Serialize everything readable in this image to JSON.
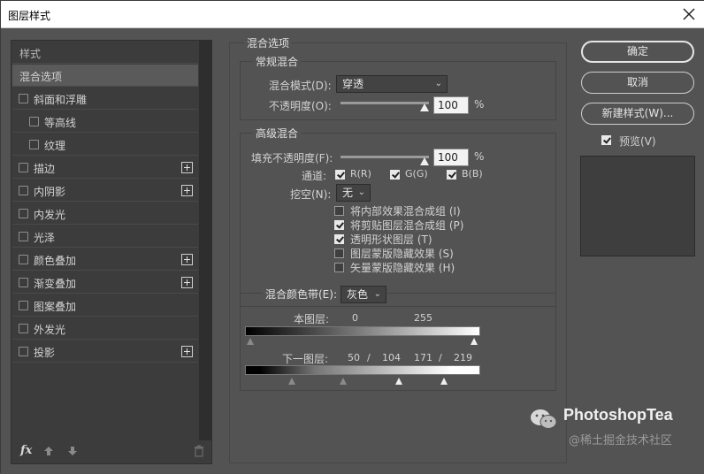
{
  "window": {
    "title": "图层样式"
  },
  "left_panel": {
    "items": [
      {
        "label": "样式",
        "checkbox": false,
        "plus": false,
        "selected": false,
        "indent": 0
      },
      {
        "label": "混合选项",
        "checkbox": false,
        "plus": false,
        "selected": true,
        "indent": 0
      },
      {
        "label": "斜面和浮雕",
        "checkbox": true,
        "plus": false,
        "selected": false,
        "indent": 0
      },
      {
        "label": "等高线",
        "checkbox": true,
        "plus": false,
        "selected": false,
        "indent": 1
      },
      {
        "label": "纹理",
        "checkbox": true,
        "plus": false,
        "selected": false,
        "indent": 1
      },
      {
        "label": "描边",
        "checkbox": true,
        "plus": true,
        "selected": false,
        "indent": 0
      },
      {
        "label": "内阴影",
        "checkbox": true,
        "plus": true,
        "selected": false,
        "indent": 0
      },
      {
        "label": "内发光",
        "checkbox": true,
        "plus": false,
        "selected": false,
        "indent": 0
      },
      {
        "label": "光泽",
        "checkbox": true,
        "plus": false,
        "selected": false,
        "indent": 0
      },
      {
        "label": "颜色叠加",
        "checkbox": true,
        "plus": true,
        "selected": false,
        "indent": 0
      },
      {
        "label": "渐变叠加",
        "checkbox": true,
        "plus": true,
        "selected": false,
        "indent": 0
      },
      {
        "label": "图案叠加",
        "checkbox": true,
        "plus": false,
        "selected": false,
        "indent": 0
      },
      {
        "label": "外发光",
        "checkbox": true,
        "plus": false,
        "selected": false,
        "indent": 0
      },
      {
        "label": "投影",
        "checkbox": true,
        "plus": true,
        "selected": false,
        "indent": 0
      }
    ],
    "fx_label": "fx"
  },
  "blend_options": {
    "section_title": "混合选项",
    "general": {
      "title": "常规混合",
      "mode_label": "混合模式(D):",
      "mode_value": "穿透",
      "opacity_label": "不透明度(O):",
      "opacity_value": "100",
      "opacity_unit": "%",
      "opacity_level": 1.0
    },
    "advanced": {
      "title": "高级混合",
      "fill_label": "填充不透明度(F):",
      "fill_value": "100",
      "fill_unit": "%",
      "fill_level": 1.0,
      "channels_label": "通道:",
      "channels": [
        {
          "label": "R(R)",
          "checked": true
        },
        {
          "label": "G(G)",
          "checked": true
        },
        {
          "label": "B(B)",
          "checked": true
        }
      ],
      "knockout_label": "挖空(N):",
      "knockout_value": "无",
      "options": [
        {
          "label": "将内部效果混合成组 (I)",
          "checked": false
        },
        {
          "label": "将剪贴图层混合成组 (P)",
          "checked": true
        },
        {
          "label": "透明形状图层 (T)",
          "checked": true
        },
        {
          "label": "图层蒙版隐藏效果 (S)",
          "checked": false
        },
        {
          "label": "矢量蒙版隐藏效果 (H)",
          "checked": false
        }
      ]
    },
    "blend_if": {
      "label": "混合颜色带(E):",
      "value": "灰色",
      "this_layer_label": "本图层:",
      "this_layer_low": "0",
      "this_layer_high": "255",
      "underlying_label": "下一图层:",
      "underlying_values": [
        "50",
        "/",
        "104",
        "171",
        "/",
        "219"
      ]
    }
  },
  "right_panel": {
    "ok_label": "确定",
    "cancel_label": "取消",
    "new_style_label": "新建样式(W)...",
    "preview_label": "预览(V)",
    "preview_checked": true
  },
  "watermark": {
    "title": "PhotoshopTea",
    "subtitle": "@稀土掘金技术社区"
  }
}
